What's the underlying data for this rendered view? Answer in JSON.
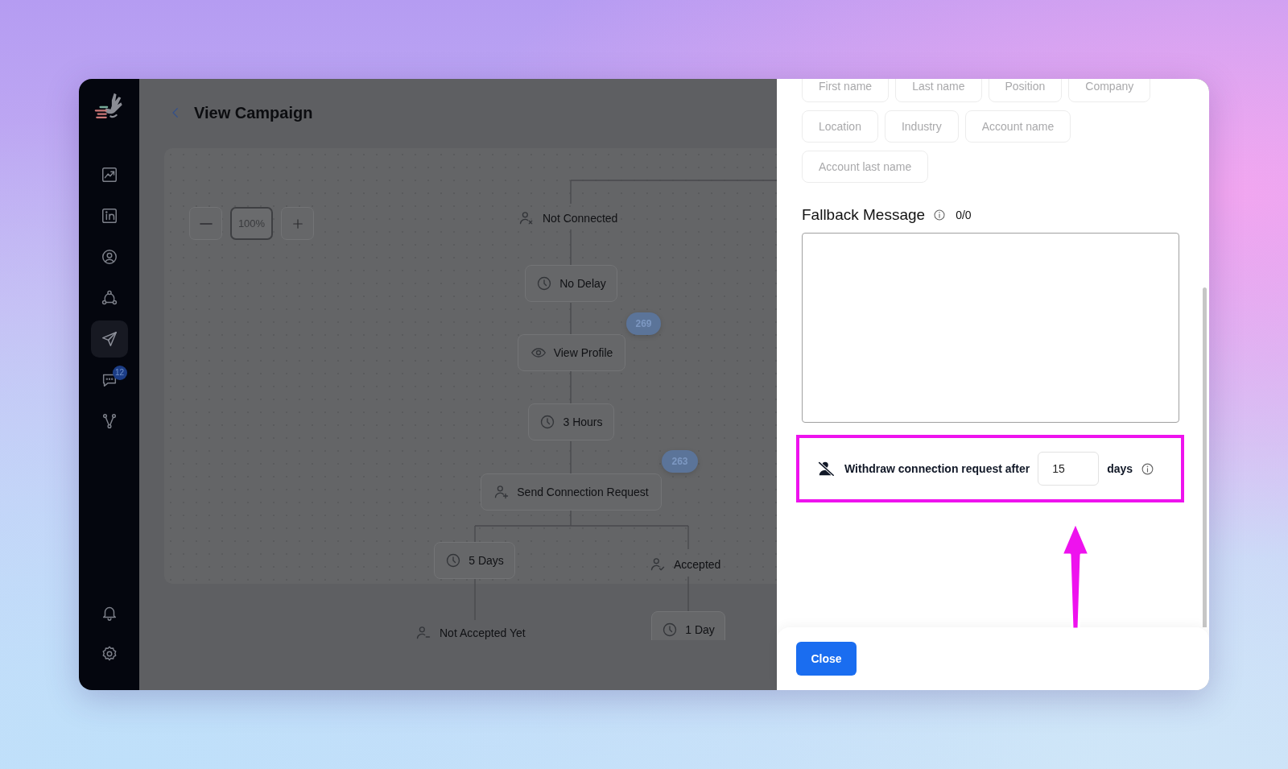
{
  "sidebar": {
    "items": [
      {
        "selected": false
      },
      {
        "selected": false
      },
      {
        "selected": false
      },
      {
        "selected": false
      },
      {
        "selected": true
      },
      {
        "selected": false,
        "badge": "12"
      },
      {
        "selected": false
      }
    ],
    "bottom_items": [
      {
        "selected": false
      },
      {
        "selected": false
      }
    ]
  },
  "header": {
    "title": "View Campaign"
  },
  "zoom_controls": {
    "value": "100%"
  },
  "flow": {
    "nodes": [
      {
        "kind": "disconnected",
        "label": "Not Connected"
      },
      {
        "kind": "wait",
        "label": "No Delay"
      },
      {
        "kind": "visit",
        "label": "View Profile"
      },
      {
        "kind": "wait",
        "label": "3 Hours"
      },
      {
        "kind": "invite",
        "label": "Send Connection Request"
      },
      {
        "kind": "wait",
        "label": "5 Days"
      },
      {
        "kind": "accepted",
        "label": "Accepted"
      },
      {
        "kind": "pending",
        "label": "Not Accepted Yet"
      },
      {
        "kind": "wait",
        "label": "1 Day"
      }
    ],
    "counts": [
      "269",
      "263"
    ]
  },
  "panel": {
    "variables": [
      "First name",
      "Last name",
      "Position",
      "Company",
      "Location",
      "Industry",
      "Account name",
      "Account last name"
    ],
    "fallback": {
      "label": "Fallback Message",
      "counter": "0/0"
    },
    "withdraw": {
      "label": "Withdraw connection request after",
      "value": "15",
      "unit": "days"
    },
    "footer": {
      "button": "Close"
    }
  }
}
